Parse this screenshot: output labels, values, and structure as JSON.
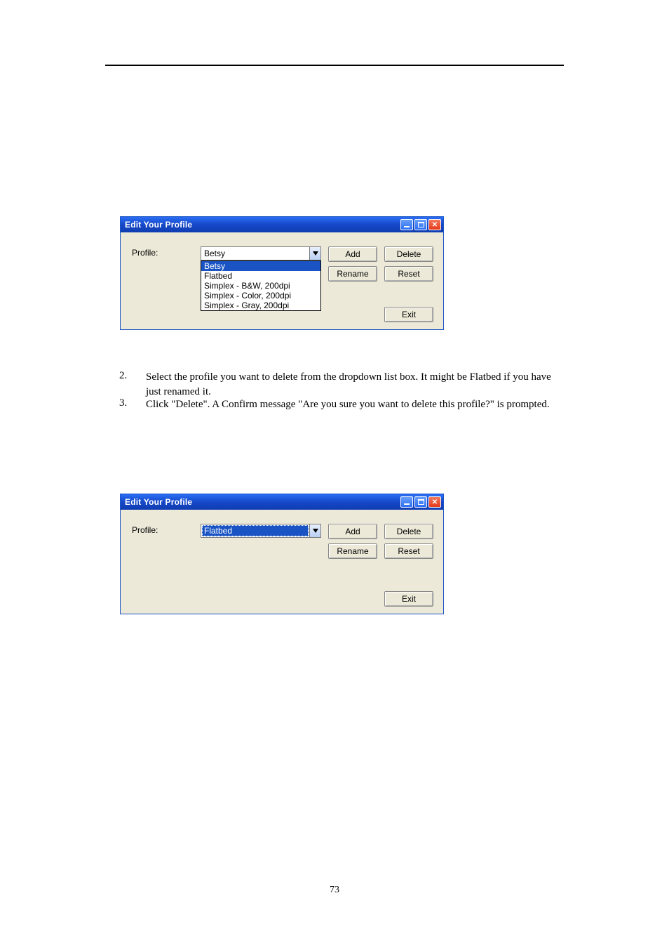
{
  "dialog": {
    "title": "Edit Your Profile",
    "profile_label": "Profile:",
    "buttons": {
      "add": "Add",
      "delete": "Delete",
      "rename": "Rename",
      "reset": "Reset",
      "exit": "Exit"
    }
  },
  "dlg1": {
    "combo_value": "Betsy",
    "dropdown_items": [
      "Betsy",
      "Flatbed",
      "Simplex - B&W, 200dpi",
      "Simplex - Color, 200dpi",
      "Simplex - Gray, 200dpi"
    ],
    "highlight_index": 0
  },
  "dlg2": {
    "combo_value": "Flatbed"
  },
  "steps": {
    "s2_num": "2.",
    "s2_text": "Select the profile you want to delete from the dropdown list box. It might be Flatbed if you have just renamed it.",
    "s3_num": "3.",
    "s3_text": "Click \"Delete\". A Confirm message \"Are you sure you want to delete this profile?\" is prompted."
  },
  "page_number": "73"
}
